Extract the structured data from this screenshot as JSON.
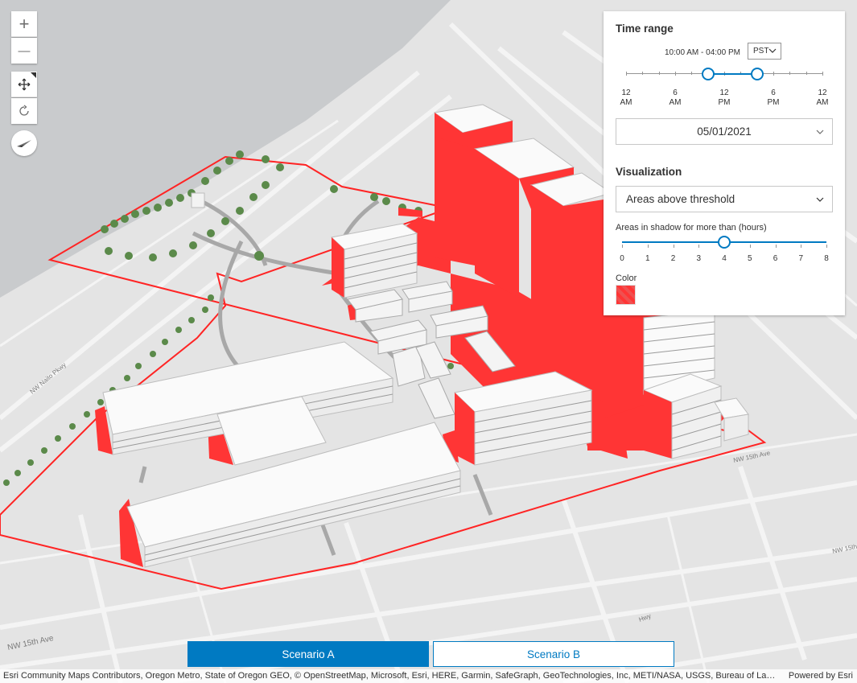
{
  "map": {
    "street_labels": [
      "NW Naito Pkwy",
      "NW 15th Ave",
      "NW 15th Ave",
      "NW 15th Ave",
      "Hwy"
    ]
  },
  "nav": {
    "zoom_in": "+",
    "zoom_out": "—"
  },
  "panel": {
    "time_range_title": "Time range",
    "time_value": "10:00 AM - 04:00 PM",
    "timezone": "PST",
    "time_ticks": [
      {
        "hour": "12",
        "ampm": "AM"
      },
      {
        "hour": "6",
        "ampm": "AM"
      },
      {
        "hour": "12",
        "ampm": "PM"
      },
      {
        "hour": "6",
        "ampm": "PM"
      },
      {
        "hour": "12",
        "ampm": "AM"
      }
    ],
    "time_start_hour": 10,
    "time_end_hour": 16,
    "date": "05/01/2021",
    "visualization_title": "Visualization",
    "visualization_value": "Areas above threshold",
    "threshold_label": "Areas in shadow for more than (hours)",
    "threshold_ticks": [
      "0",
      "1",
      "2",
      "3",
      "4",
      "5",
      "6",
      "7",
      "8"
    ],
    "threshold_value": 4,
    "color_label": "Color",
    "shadow_color": "#ff3535"
  },
  "scenarios": {
    "a_label": "Scenario A",
    "b_label": "Scenario B"
  },
  "attribution": {
    "text": "Esri Community Maps Contributors, Oregon Metro, State of Oregon GEO, © OpenStreetMap, Microsoft, Esri, HERE, Garmin, SafeGraph, GeoTechnologies, Inc, METI/NASA, USGS, Bureau of Land Management, EPA, NPS, US Census Bureau, USDA",
    "powered_by": "Powered by Esri"
  },
  "colors": {
    "accent": "#007ac2",
    "shadow": "#ff3535",
    "water": "#c9cbcd",
    "land": "#e3e3e3"
  }
}
